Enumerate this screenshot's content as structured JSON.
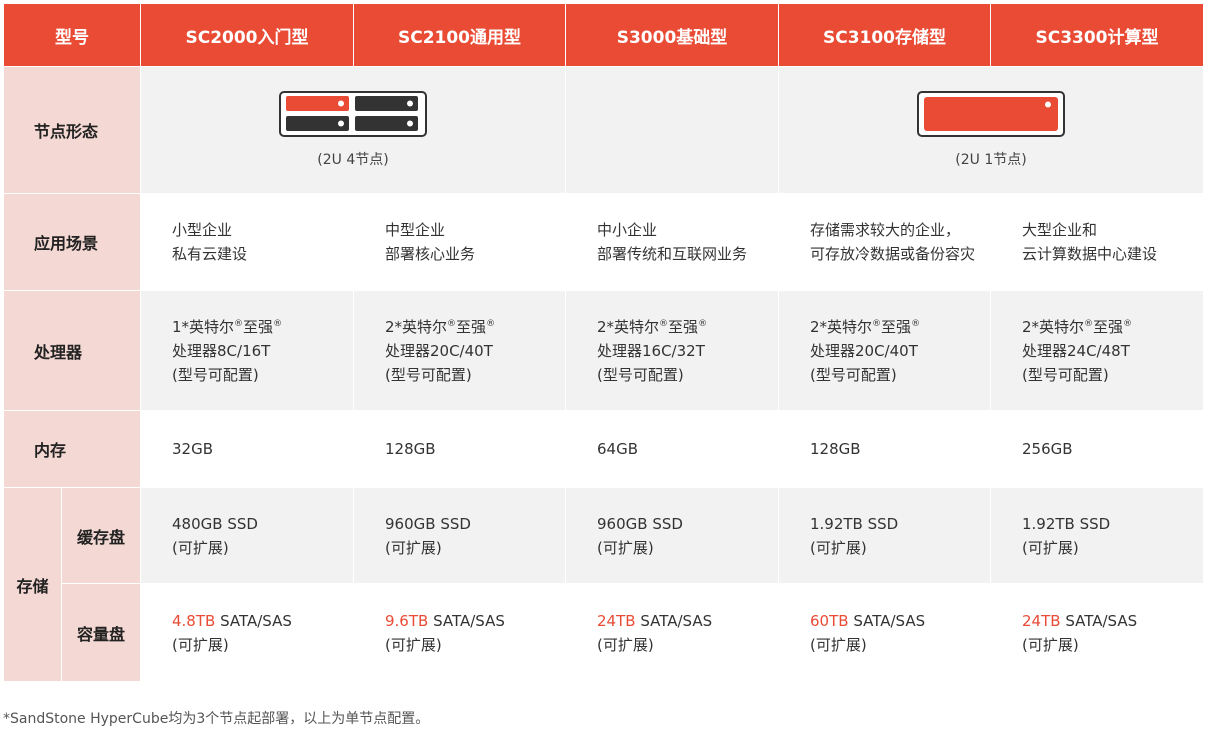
{
  "header": {
    "label": "型号",
    "models": [
      "SC2000入门型",
      "SC2100通用型",
      "S3000基础型",
      "SC3100存储型",
      "SC3300计算型"
    ]
  },
  "node_form": {
    "label": "节点形态",
    "group_a": {
      "caption": "(2U 4节点)",
      "icon": "server-2u-4node-icon"
    },
    "group_b": {
      "caption": "(2U 1节点)",
      "icon": "server-2u-1node-icon"
    }
  },
  "scenario": {
    "label": "应用场景",
    "cells": [
      [
        "小型企业",
        "私有云建设"
      ],
      [
        "中型企业",
        "部署核心业务"
      ],
      [
        "中小企业",
        "部署传统和互联网业务"
      ],
      [
        "存储需求较大的企业，",
        "可存放冷数据或备份容灾"
      ],
      [
        "大型企业和",
        "云计算数据中心建设"
      ]
    ]
  },
  "cpu": {
    "label": "处理器",
    "cells": [
      {
        "prefix": "1*英特尔",
        "mid": "至强",
        "model": "处理器8C/16T",
        "note": "(型号可配置)"
      },
      {
        "prefix": "2*英特尔",
        "mid": "至强",
        "model": "处理器20C/40T",
        "note": "(型号可配置)"
      },
      {
        "prefix": "2*英特尔",
        "mid": "至强",
        "model": "处理器16C/32T",
        "note": "(型号可配置)"
      },
      {
        "prefix": "2*英特尔",
        "mid": "至强",
        "model": "处理器20C/40T",
        "note": "(型号可配置)"
      },
      {
        "prefix": "2*英特尔",
        "mid": "至强",
        "model": "处理器24C/48T",
        "note": "(型号可配置)"
      }
    ],
    "reg_mark": "®"
  },
  "memory": {
    "label": "内存",
    "cells": [
      "32GB",
      "128GB",
      "64GB",
      "128GB",
      "256GB"
    ]
  },
  "storage": {
    "label": "存储",
    "cache": {
      "label": "缓存盘",
      "cells": [
        [
          "480GB SSD",
          "(可扩展)"
        ],
        [
          "960GB SSD",
          "(可扩展)"
        ],
        [
          "960GB SSD",
          "(可扩展)"
        ],
        [
          "1.92TB SSD",
          "(可扩展)"
        ],
        [
          "1.92TB SSD",
          "(可扩展)"
        ]
      ]
    },
    "capacity": {
      "label": "容量盘",
      "cells": [
        {
          "size": "4.8TB",
          "type": " SATA/SAS",
          "note": "(可扩展)"
        },
        {
          "size": "9.6TB",
          "type": " SATA/SAS",
          "note": "(可扩展)"
        },
        {
          "size": "24TB",
          "type": " SATA/SAS",
          "note": "(可扩展)"
        },
        {
          "size": "60TB",
          "type": " SATA/SAS",
          "note": "(可扩展)"
        },
        {
          "size": "24TB",
          "type": " SATA/SAS",
          "note": "(可扩展)"
        }
      ]
    }
  },
  "footnote": "*SandStone HyperCube均为3个节点起部署，以上为单节点配置。",
  "colors": {
    "accent": "#e94b35",
    "label_bg": "#f4d8d3",
    "grey_row": "#f2f2f2",
    "server_dark": "#333333"
  }
}
